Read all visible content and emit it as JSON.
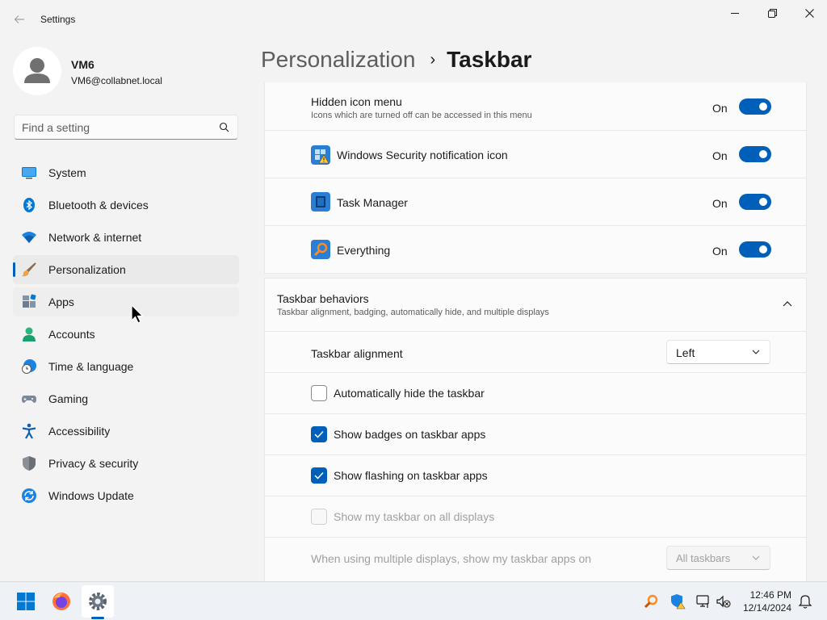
{
  "window": {
    "title": "Settings",
    "back_icon": "arrow-left-icon",
    "minimize_icon": "minimize-icon",
    "maximize_icon": "restore-icon",
    "close_icon": "close-icon"
  },
  "profile": {
    "name": "VM6",
    "email": "VM6@collabnet.local"
  },
  "search": {
    "placeholder": "Find a setting",
    "value": ""
  },
  "sidebar": {
    "items": [
      {
        "label": "System",
        "icon": "monitor-icon"
      },
      {
        "label": "Bluetooth & devices",
        "icon": "bluetooth-icon"
      },
      {
        "label": "Network & internet",
        "icon": "wifi-icon"
      },
      {
        "label": "Personalization",
        "icon": "paintbrush-icon",
        "selected": true
      },
      {
        "label": "Apps",
        "icon": "apps-icon",
        "hover": true
      },
      {
        "label": "Accounts",
        "icon": "person-icon"
      },
      {
        "label": "Time & language",
        "icon": "globe-clock-icon"
      },
      {
        "label": "Gaming",
        "icon": "gamepad-icon"
      },
      {
        "label": "Accessibility",
        "icon": "accessibility-icon"
      },
      {
        "label": "Privacy & security",
        "icon": "shield-icon"
      },
      {
        "label": "Windows Update",
        "icon": "sync-icon"
      }
    ]
  },
  "breadcrumb": {
    "parent": "Personalization",
    "separator": "›",
    "current": "Taskbar"
  },
  "hidden_icons": {
    "title": "Hidden icon menu",
    "subtitle": "Icons which are turned off can be accessed in this menu",
    "state": "On",
    "items": [
      {
        "label": "Windows Security notification icon",
        "state": "On",
        "icon": "windows-security-icon"
      },
      {
        "label": "Task Manager",
        "state": "On",
        "icon": "task-manager-icon"
      },
      {
        "label": "Everything",
        "state": "On",
        "icon": "everything-search-icon"
      }
    ]
  },
  "behaviors": {
    "title": "Taskbar behaviors",
    "subtitle": "Taskbar alignment, badging, automatically hide, and multiple displays",
    "alignment_label": "Taskbar alignment",
    "alignment_value": "Left",
    "auto_hide": {
      "label": "Automatically hide the taskbar",
      "checked": false
    },
    "badges": {
      "label": "Show badges on taskbar apps",
      "checked": true
    },
    "flashing": {
      "label": "Show flashing on taskbar apps",
      "checked": true
    },
    "all_displays": {
      "label": "Show my taskbar on all displays",
      "checked": false,
      "disabled": true
    },
    "multi_display_label": "When using multiple displays, show my taskbar apps on",
    "multi_display_value": "All taskbars"
  },
  "taskbar": {
    "apps": [
      "windows-start-icon",
      "firefox-icon",
      "settings-gear-icon"
    ],
    "tray": [
      "everything-tray-icon",
      "windows-security-tray-icon",
      "network-tray-icon",
      "volume-muted-icon",
      "bell-icon"
    ],
    "time": "12:46 PM",
    "date": "12/14/2024"
  },
  "colors": {
    "accent": "#005fb8",
    "background": "#f3f3f3",
    "card": "#fbfbfb"
  }
}
